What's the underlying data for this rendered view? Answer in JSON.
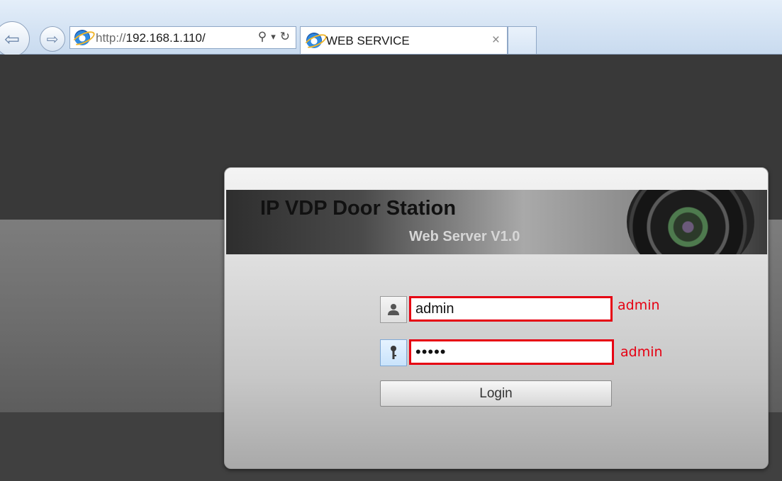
{
  "browser": {
    "url_prefix": "http://",
    "url_host": "192.168.1.110/",
    "tab_title": "WEB SERVICE",
    "tab_close": "×",
    "search_glyph": "⚲",
    "dropdown_glyph": "▾",
    "refresh_glyph": "↻",
    "back_glyph": "⇦",
    "forward_glyph": "⇨"
  },
  "login": {
    "title": "IP VDP Door Station",
    "subtitle": "Web Server V1.0",
    "username_value": "admin",
    "password_value": "•••••",
    "login_label": "Login",
    "user_icon": "👤",
    "key_icon": "⚷"
  },
  "annotations": {
    "username_hint": "admin",
    "password_hint": "admin",
    "color": "#e60012"
  }
}
